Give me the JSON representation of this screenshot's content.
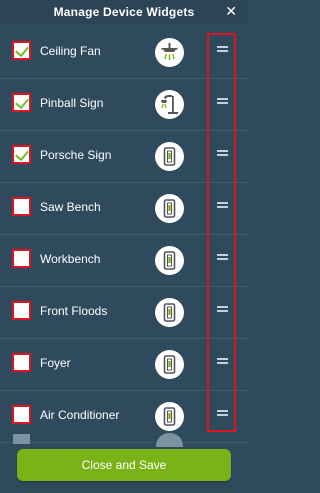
{
  "header": {
    "title": "Manage Device Widgets",
    "close_glyph": "✕"
  },
  "colors": {
    "background": "#2f4a5d",
    "highlight": "#e0141e",
    "checkmark": "#6bbf2a",
    "save_button": "#7ab317"
  },
  "devices": [
    {
      "label": "Ceiling Fan",
      "checked": true,
      "icon": "ceiling-fan-icon"
    },
    {
      "label": "Pinball Sign",
      "checked": true,
      "icon": "desk-lamp-icon"
    },
    {
      "label": "Porsche Sign",
      "checked": true,
      "icon": "wall-switch-icon"
    },
    {
      "label": "Saw Bench",
      "checked": false,
      "icon": "wall-switch-icon"
    },
    {
      "label": "Workbench",
      "checked": false,
      "icon": "wall-switch-icon"
    },
    {
      "label": "Front Floods",
      "checked": false,
      "icon": "wall-switch-icon"
    },
    {
      "label": "Foyer",
      "checked": false,
      "icon": "wall-switch-icon"
    },
    {
      "label": "Air Conditioner",
      "checked": false,
      "icon": "wall-switch-icon"
    }
  ],
  "footer": {
    "save_label": "Close and Save"
  }
}
